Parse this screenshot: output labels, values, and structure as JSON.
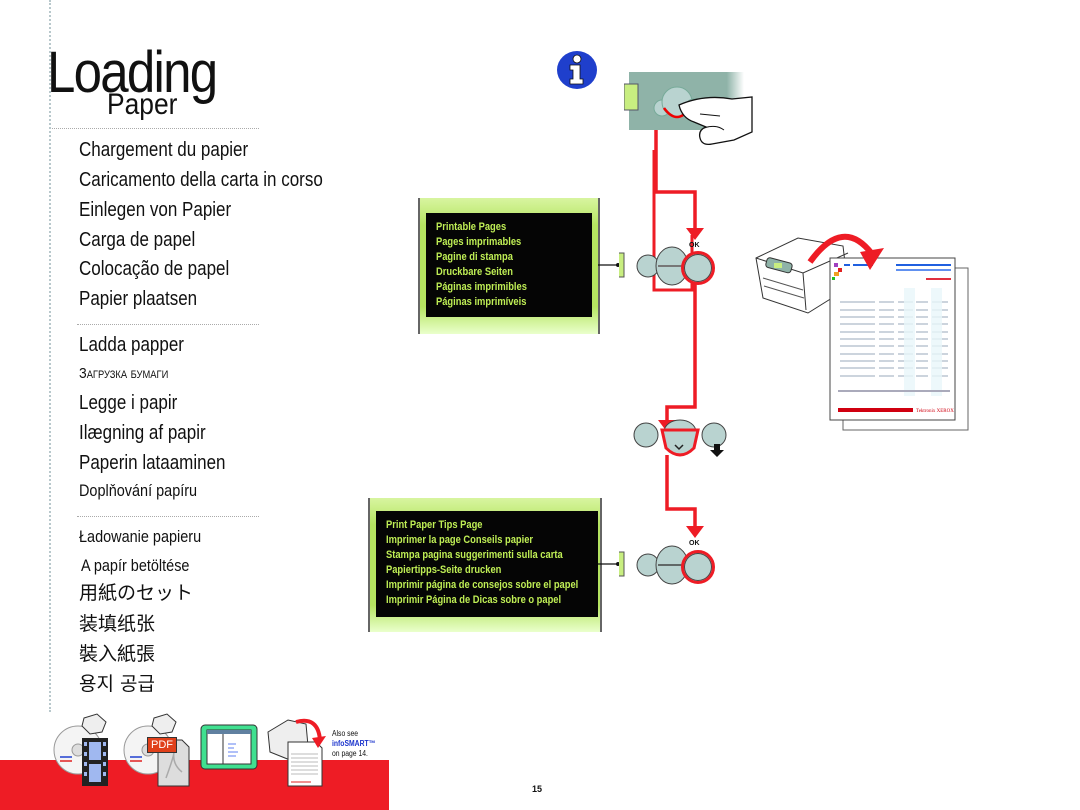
{
  "title": {
    "main": "Loading",
    "sub": "Paper"
  },
  "languages": {
    "group1": [
      "Chargement du papier",
      "Caricamento della carta in corso",
      "Einlegen von Papier",
      "Carga de papel",
      "Colocação de papel",
      "Papier plaatsen"
    ],
    "group2": [
      "Ladda papper",
      "Загрузка бумаги",
      "Legge i papir",
      "Ilægning af papir",
      "Paperin lataaminen",
      "Doplňování papíru"
    ],
    "group3": [
      "Ładowanie papieru",
      "A papír betöltése",
      "用紙のセット",
      "装填纸张",
      "裝入紙張",
      "용지 공급"
    ]
  },
  "panel1": {
    "lines": [
      "Printable Pages",
      "Pages imprimables",
      "Pagine di stampa",
      "Druckbare Seiten",
      "Páginas imprimibles",
      "Páginas imprimíveis"
    ],
    "ok_label": "OK"
  },
  "panel2": {
    "lines": [
      "Print Paper Tips Page",
      "Imprimer la page Conseils papier",
      "Stampa pagina suggerimenti sulla carta",
      "Papiertipps-Seite drucken",
      "Imprimir página de consejos sobre el papel",
      "Imprimir Página de Dicas sobre o papel"
    ],
    "ok_label": "OK"
  },
  "icons": {
    "info": "info-icon",
    "video": "video-cd-icon",
    "pdf": "pdf-cd-icon",
    "web": "web-browser-icon",
    "infosmart": "printer-page-icon",
    "pdf_label": "PDF"
  },
  "also_see": {
    "prefix": "Also see",
    "link": "infoSMART™",
    "suffix": "on page 14."
  },
  "printout_brand": "Tektronix XEROX",
  "page_number": "15",
  "colors": {
    "accent_red": "#ee1c25",
    "lcd_green": "#b5e461",
    "lcd_text": "#bfee55",
    "button_fill": "#b9d3d0",
    "info_blue": "#1f3fcc"
  }
}
